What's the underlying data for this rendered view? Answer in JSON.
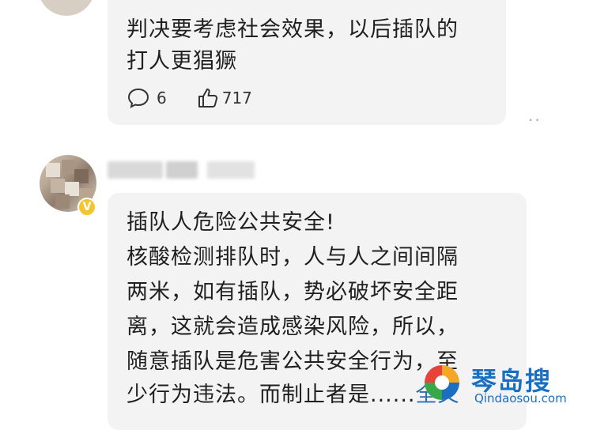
{
  "comment1": {
    "lines": [
      "判决要考虑社会效果，以后插队的",
      "打人更猖獗"
    ],
    "reply_count": "6",
    "like_count": "717",
    "icons": {
      "reply": "comment-bubble-icon",
      "like": "thumbs-up-icon"
    }
  },
  "more_menu": "··",
  "comment2": {
    "badge": "V",
    "lines": [
      "插队人危险公共安全!",
      "核酸检测排队时，人与人之间间隔",
      "两米，如有插队，势必破坏安全距",
      "离，这就会造成感染风险，所以，",
      "随意插队是危害公共安全行为，至",
      "少行为违法。而制止者是......"
    ],
    "expand_label": "全文"
  },
  "watermark": {
    "title": "琴岛搜",
    "url": "Qindaosou.com"
  },
  "colors": {
    "bubble": "#f3f3f3",
    "link": "#2f6db5",
    "badge": "#f4c431",
    "watermark": "#1a6fc2"
  }
}
